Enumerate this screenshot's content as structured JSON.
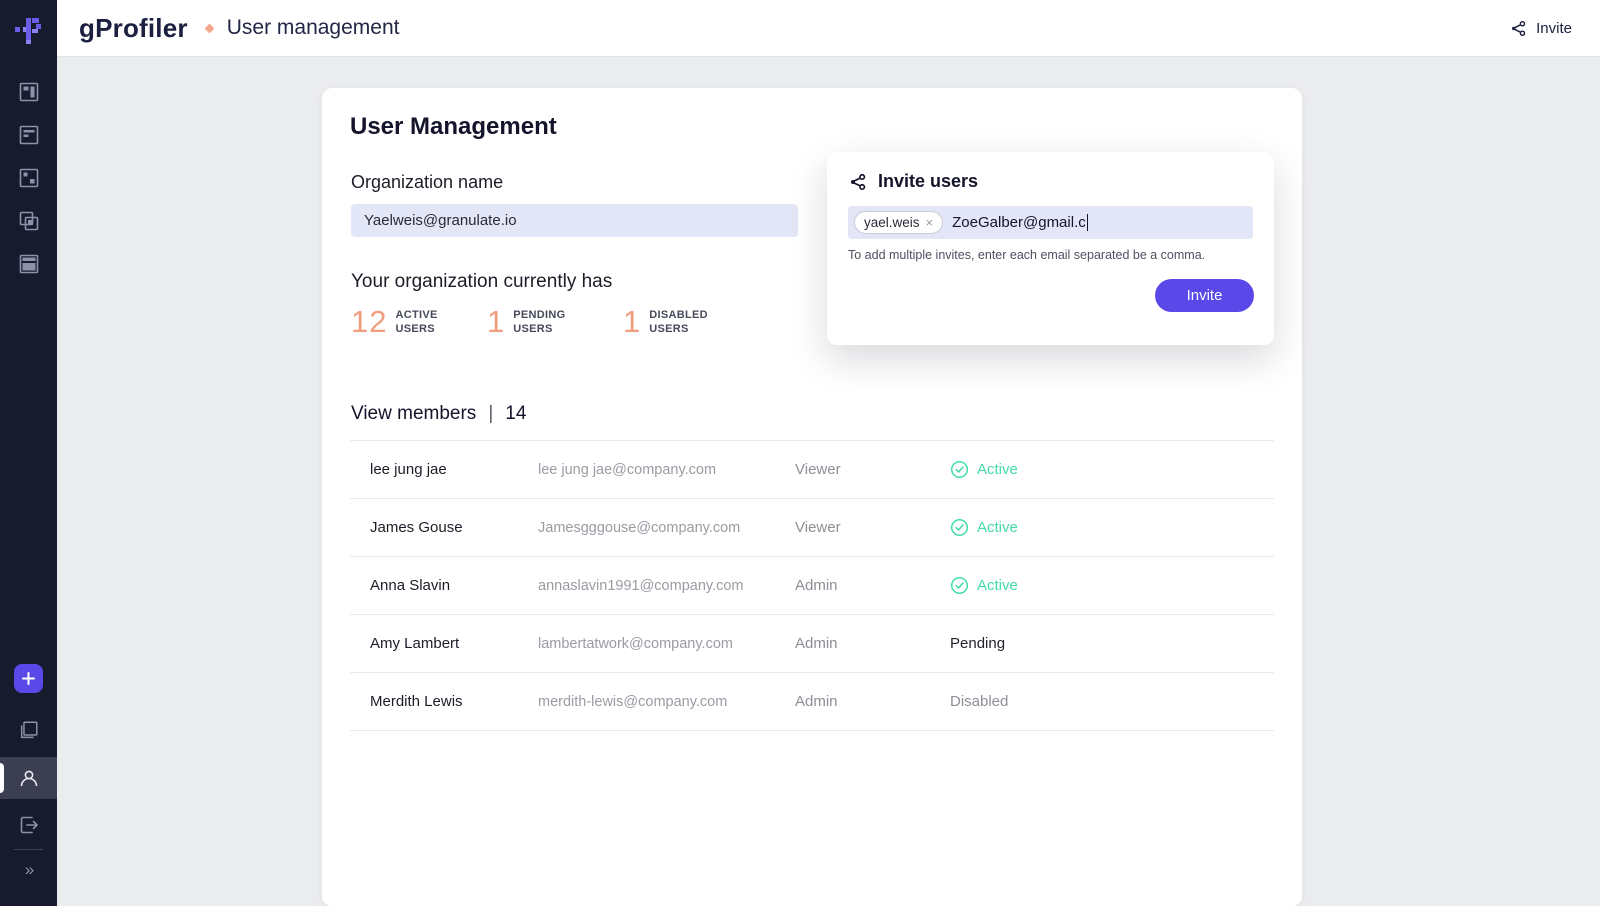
{
  "header": {
    "brand": "gProfiler",
    "page_title": "User management",
    "invite_label": "Invite"
  },
  "sidebar": {
    "icons": [
      "dashboard-icon",
      "report-icon",
      "flamegraph-icon",
      "compare-icon",
      "table-view-icon",
      "add-icon",
      "copy-icon",
      "profile-icon",
      "logout-icon"
    ],
    "collapse_glyph": "»",
    "active_item": "profile"
  },
  "main": {
    "title": "User Management",
    "org": {
      "label": "Organization name",
      "value": "Yaelweis@granulate.io"
    },
    "stats": {
      "heading": "Your organization currently has",
      "items": [
        {
          "value": "12",
          "label_line1": "ACTIVE",
          "label_line2": "USERS"
        },
        {
          "value": "1",
          "label_line1": "PENDING",
          "label_line2": "USERS"
        },
        {
          "value": "1",
          "label_line1": "DISABLED",
          "label_line2": "USERS"
        }
      ]
    },
    "members": {
      "heading": "View members",
      "divider": "|",
      "count": "14"
    }
  },
  "invite_card": {
    "title": "Invite users",
    "chip": {
      "label": "yael.weis",
      "remove_glyph": "×"
    },
    "input_value": "ZoeGalber@gmail.c",
    "helper": "To add multiple invites, enter each email separated be a comma.",
    "button_label": "Invite"
  },
  "table": {
    "rows": [
      {
        "name": "lee jung jae",
        "email": "lee jung jae@company.com",
        "role": "Viewer",
        "status": "Active",
        "status_type": "active"
      },
      {
        "name": "James Gouse",
        "email": "Jamesgggouse@company.com",
        "role": "Viewer",
        "status": "Active",
        "status_type": "active"
      },
      {
        "name": "Anna Slavin",
        "email": "annaslavin1991@company.com",
        "role": "Admin",
        "status": "Active",
        "status_type": "active"
      },
      {
        "name": "Amy Lambert",
        "email": "lambertatwork@company.com",
        "role": "Admin",
        "status": "Pending",
        "status_type": "pending"
      },
      {
        "name": "Merdith Lewis",
        "email": "merdith-lewis@company.com",
        "role": "Admin",
        "status": "Disabled",
        "status_type": "disabled"
      }
    ]
  },
  "colors": {
    "sidebar_navy": "#181B2D",
    "accent_purple": "#5A49E8",
    "logo_purple": "#6C5CE7",
    "stat_salmon": "#F19C7C",
    "status_green": "#43DCA7",
    "input_lavender": "#E3E6F7",
    "content_bg": "#EBECEE"
  }
}
